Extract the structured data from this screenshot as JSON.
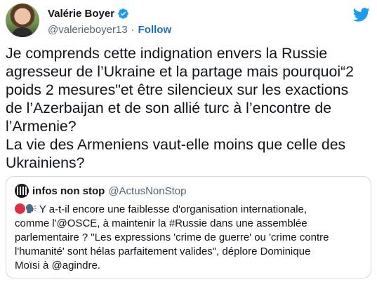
{
  "author": {
    "display_name": "Valérie Boyer",
    "handle": "@valerieboyer13",
    "separator": "·",
    "follow_label": "Follow"
  },
  "tweet": {
    "text": "Je comprends cette indignation envers la Russie\nagresseur de l’Ukraine et la partage mais pourquoi“2\npoids 2 mesures\"et être silencieux sur les exactions\nde l’Azerbaijan et de son allié turc à l’encontre de\nl’Armenie?\nLa vie des Armeniens vaut-elle moins que celle des\nUkrainiens?"
  },
  "quote": {
    "display_name": "infos non stop",
    "handle": "@ActusNonStop",
    "text": " Y a-t-il encore une faiblesse d'organisation internationale,\ncomme l'@OSCE, à maintenir la #Russie dans une assemblée\nparlementaire ? \"Les expressions 'crime de guerre' ou 'crime contre\nl'humanité' sont hélas parfaitement valides\", déplore Dominique\nMoïsi à @agindre."
  },
  "icons": {
    "verified": "verified-badge-icon",
    "brand": "twitter-bird-icon",
    "emoji_1": "red-circle-icon",
    "emoji_2": "speaking-head-icon"
  },
  "colors": {
    "verified": "#1d9bf0",
    "twitter_brand": "#1d9bf0",
    "follow_link": "#1d6fb8",
    "secondary_text": "#536471",
    "border": "#cfd9de"
  }
}
